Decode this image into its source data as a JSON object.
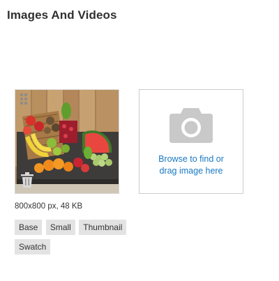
{
  "section": {
    "title": "Images And Videos"
  },
  "image": {
    "meta": "800x800 px, 48 KB",
    "roles": [
      "Base",
      "Small",
      "Thumbnail",
      "Swatch"
    ]
  },
  "upload": {
    "line1": "Browse to find or",
    "line2": "drag image here"
  },
  "icons": {
    "drag": "drag-handle-icon",
    "remove": "trash-icon",
    "upload": "camera-icon"
  },
  "colors": {
    "link": "#1979c3",
    "tag_bg": "#e3e3e3",
    "border": "#cccccc"
  }
}
